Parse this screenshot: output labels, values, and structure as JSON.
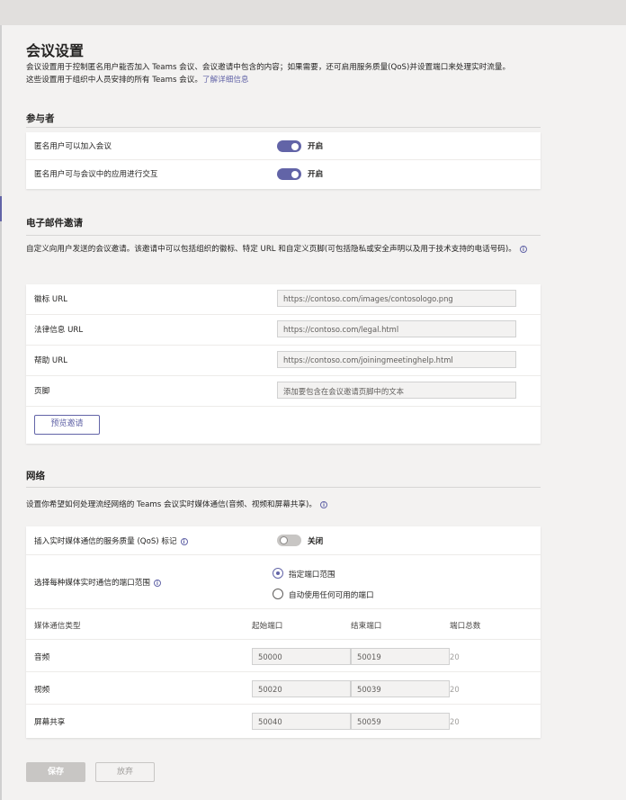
{
  "page": {
    "title": "会议设置",
    "description": "会议设置用于控制匿名用户能否加入 Teams 会议、会议邀请中包含的内容；如果需要，还可启用服务质量(QoS)并设置端口来处理实时流量。这些设置用于组织中人员安排的所有 Teams 会议。",
    "learn_more": "了解详细信息"
  },
  "participants": {
    "title": "参与者",
    "rows": [
      {
        "label": "匿名用户可以加入会议",
        "state": "开启"
      },
      {
        "label": "匿名用户可与会议中的应用进行交互",
        "state": "开启"
      }
    ]
  },
  "email": {
    "title": "电子邮件邀请",
    "description": "自定义向用户发送的会议邀请。该邀请中可以包括组织的徽标、特定 URL 和自定义页脚(可包括隐私或安全声明以及用于技术支持的电话号码)。",
    "rows": [
      {
        "label": "徽标 URL",
        "value": "https://contoso.com/images/contosologo.png"
      },
      {
        "label": "法律信息 URL",
        "value": "https://contoso.com/legal.html"
      },
      {
        "label": "帮助 URL",
        "value": "https://contoso.com/joiningmeetinghelp.html"
      },
      {
        "label": "页脚",
        "value": "添加要包含在会议邀请页脚中的文本"
      }
    ],
    "preview_button": "预览邀请"
  },
  "network": {
    "title": "网络",
    "description": "设置你希望如何处理流经网络的 Teams 会议实时媒体通信(音频、视频和屏幕共享)。",
    "qos_label": "插入实时媒体通信的服务质量 (QoS) 标记",
    "qos_state": "关闭",
    "port_range_label": "选择每种媒体实时通信的端口范围",
    "radio_options": [
      "指定端口范围",
      "自动使用任何可用的端口"
    ],
    "table": {
      "headers": [
        "媒体通信类型",
        "起始端口",
        "结束端口",
        "端口总数"
      ],
      "rows": [
        {
          "type": "音频",
          "start": "50000",
          "end": "50019",
          "total": "20"
        },
        {
          "type": "视频",
          "start": "50020",
          "end": "50039",
          "total": "20"
        },
        {
          "type": "屏幕共享",
          "start": "50040",
          "end": "50059",
          "total": "20"
        }
      ]
    }
  },
  "footer": {
    "save": "保存",
    "discard": "放弃"
  },
  "colors": {
    "accent": "#6264a7",
    "background": "#f3f2f1"
  }
}
